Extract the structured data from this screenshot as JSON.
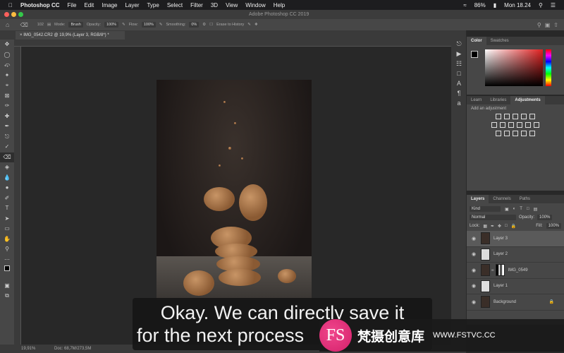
{
  "menubar": {
    "app": "Photoshop CC",
    "items": [
      "File",
      "Edit",
      "Image",
      "Layer",
      "Type",
      "Select",
      "Filter",
      "3D",
      "View",
      "Window",
      "Help"
    ],
    "battery": "86%",
    "clock": "Mon 18.24"
  },
  "titlebar": {
    "title": "Adobe Photoshop CC 2019"
  },
  "options": {
    "brush_size": "102",
    "mode_label": "Mode:",
    "mode": "Brush",
    "opacity_label": "Opacity:",
    "opacity": "100%",
    "flow_label": "Flow:",
    "flow": "100%",
    "smoothing_label": "Smoothing:",
    "smoothing": "0%",
    "erase_history": "Erase to History"
  },
  "document": {
    "tab": "IMG_0542.CR2 @ 19,9% (Layer 3, RGB/8*) *"
  },
  "status": {
    "zoom": "19,91%",
    "doc": "Doc: 68,7M/273,5M"
  },
  "color_panel": {
    "tabs": [
      "Color",
      "Swatches"
    ],
    "accent": "#e02020"
  },
  "adjust_panel": {
    "tabs": [
      "Learn",
      "Libraries",
      "Adjustments"
    ],
    "hint": "Add an adjustment"
  },
  "layers_panel": {
    "tabs": [
      "Layers",
      "Channels",
      "Paths"
    ],
    "filter": "Kind",
    "blend": "Normal",
    "opacity_label": "Opacity:",
    "opacity": "100%",
    "lock_label": "Lock:",
    "fill_label": "Fill:",
    "fill": "100%",
    "layers": [
      {
        "name": "Layer 3",
        "selected": true
      },
      {
        "name": "Layer 2"
      },
      {
        "name": "IMG_0549"
      },
      {
        "name": "Layer 1"
      },
      {
        "name": "Background",
        "locked": true
      }
    ]
  },
  "subtitle": {
    "line1": "Okay. We can directly save it",
    "line2": "for the next process"
  },
  "watermark": {
    "logo": "FS",
    "cn": "梵摄创意库",
    "url": "WWW.FSTVC.CC"
  }
}
